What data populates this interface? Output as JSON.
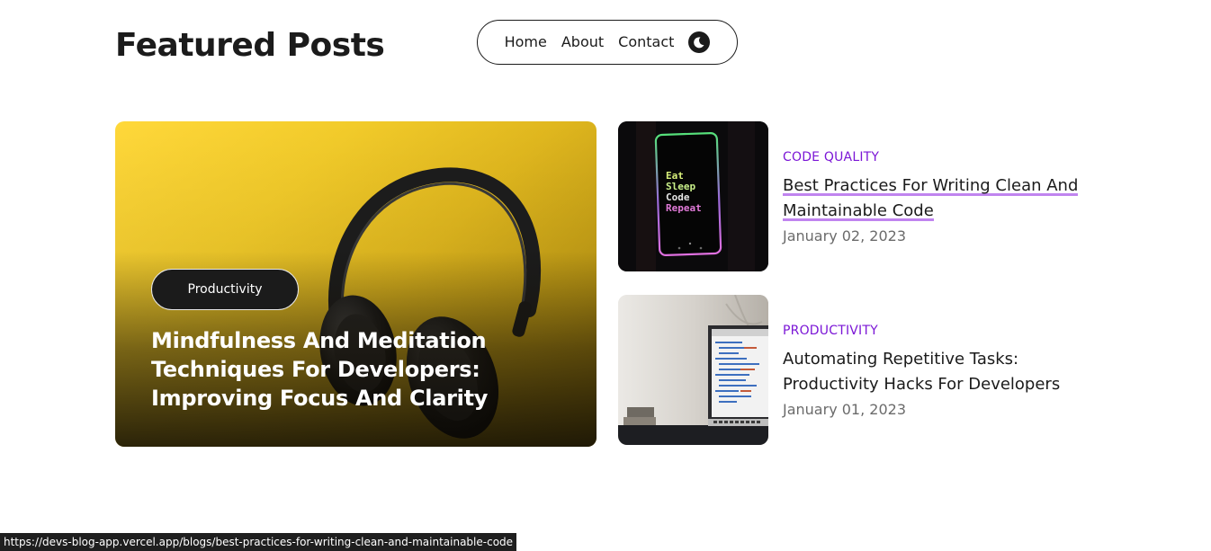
{
  "page": {
    "title": "Featured Posts"
  },
  "nav": {
    "items": [
      {
        "label": "Home"
      },
      {
        "label": "About"
      },
      {
        "label": "Contact"
      }
    ],
    "theme_icon": "moon-icon"
  },
  "hero": {
    "tag": "Productivity",
    "title": "Mindfulness And Meditation Techniques For Developers: Improving Focus And Clarity",
    "image": "headphones-image",
    "colors": {
      "background": "#f2cb2a",
      "tag_bg": "#1b1b1b"
    }
  },
  "posts": [
    {
      "category": "CODE QUALITY",
      "title": "Best Practices For Writing Clean And Maintainable Code",
      "date": "January 02, 2023",
      "image": "phone-eat-sleep-code-repeat-image",
      "phone_text": [
        "Eat",
        "Sleep",
        "Code",
        "Repeat"
      ]
    },
    {
      "category": "PRODUCTIVITY",
      "title": "Automating Repetitive Tasks: Productivity Hacks For Developers",
      "date": "January 01, 2023",
      "image": "laptop-code-image"
    }
  ],
  "status_bar": {
    "url": "https://devs-blog-app.vercel.app/blogs/best-practices-for-writing-clean-and-maintainable-code"
  },
  "colors": {
    "accent": "#7b16d6",
    "underline": "#c084ef",
    "text": "#1b1b1b",
    "muted": "#6b6b6b"
  }
}
